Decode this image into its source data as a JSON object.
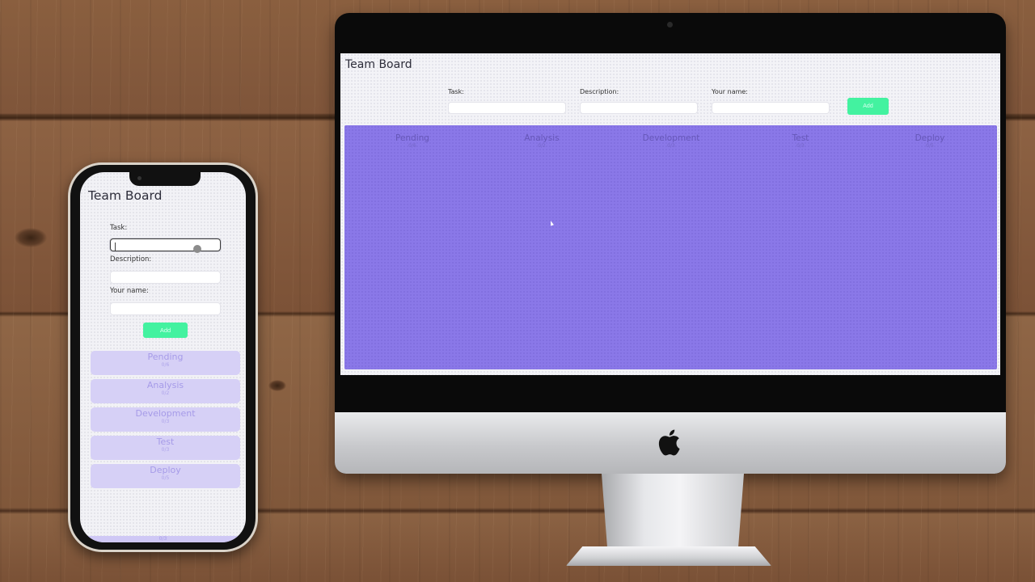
{
  "app": {
    "title": "Team Board"
  },
  "form": {
    "task_label": "Task:",
    "task_value": "",
    "description_label": "Description:",
    "description_value": "",
    "name_label": "Your name:",
    "name_value": "",
    "add_label": "Add",
    "add_color": "#43f2a0"
  },
  "board": {
    "color": "#8a78e8",
    "columns": [
      {
        "name": "Pending",
        "count": "0/6"
      },
      {
        "name": "Analysis",
        "count": "0/2"
      },
      {
        "name": "Development",
        "count": "0/3"
      },
      {
        "name": "Test",
        "count": "0/3"
      },
      {
        "name": "Deploy",
        "count": "0/5"
      }
    ]
  },
  "mobile": {
    "footer_count": "0/3"
  }
}
